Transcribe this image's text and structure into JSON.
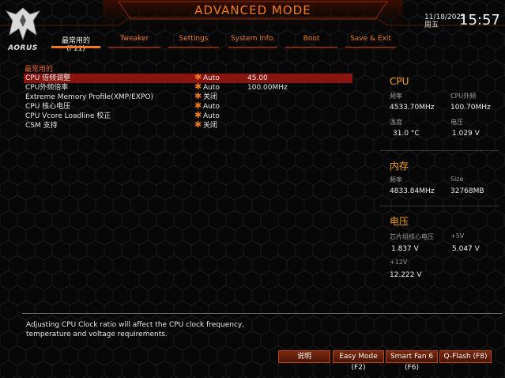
{
  "header": {
    "mode_title": "ADVANCED MODE",
    "logo_text": "AORUS",
    "date": "11/18/2022",
    "weekday": "周五",
    "time": "15:57"
  },
  "tabs": [
    {
      "label": "最常用的 (F11)",
      "active": true
    },
    {
      "label": "Tweaker",
      "active": false
    },
    {
      "label": "Settings",
      "active": false
    },
    {
      "label": "System Info.",
      "active": false
    },
    {
      "label": "Boot",
      "active": false
    },
    {
      "label": "Save & Exit",
      "active": false
    }
  ],
  "main": {
    "section_title": "最常用的",
    "rows": [
      {
        "label": "CPU 倍频调整",
        "value": "Auto",
        "value2": "45.00",
        "selected": true
      },
      {
        "label": "CPU外频倍率",
        "value": "Auto",
        "value2": "100.00MHz",
        "selected": false
      },
      {
        "label": "Extreme Memory Profile(XMP/EXPO)",
        "value": "关闭",
        "value2": "",
        "selected": false
      },
      {
        "label": "CPU 核心电压",
        "value": "Auto",
        "value2": "",
        "selected": false
      },
      {
        "label": "CPU Vcore Loadline 校正",
        "value": "Auto",
        "value2": "",
        "selected": false
      },
      {
        "label": "CSM 支持",
        "value": "关闭",
        "value2": "",
        "selected": false
      }
    ]
  },
  "cpu": {
    "title": "CPU",
    "freq_label": "频率",
    "freq_value": "4533.70MHz",
    "bclk_label": "CPU外频",
    "bclk_value": "100.70MHz",
    "temp_label": "温度",
    "temp_value": "31.0 °C",
    "volt_label": "电压",
    "volt_value": "1.029 V"
  },
  "memory": {
    "title": "内存",
    "freq_label": "频率",
    "freq_value": "4833.84MHz",
    "size_label": "Size",
    "size_value": "32768MB"
  },
  "voltage": {
    "title": "电压",
    "chipset_label": "芯片组核心电压",
    "chipset_value": "1.837 V",
    "v5_label": "+5V",
    "v5_value": "5.047 V",
    "v12_label": "+12V",
    "v12_value": "12.222 V"
  },
  "help_text": "Adjusting CPU Clock ratio will affect the CPU clock frequency, temperature and voltage requirements.",
  "footer": {
    "help_button": "说明",
    "easy_mode": "Easy Mode (F2)",
    "smart_fan": "Smart Fan 6 (F6)",
    "qflash": "Q-Flash (F8)"
  },
  "colors": {
    "accent": "#f07a23",
    "selected_row": "#8a1410",
    "panel_heading": "#f3a21c"
  }
}
